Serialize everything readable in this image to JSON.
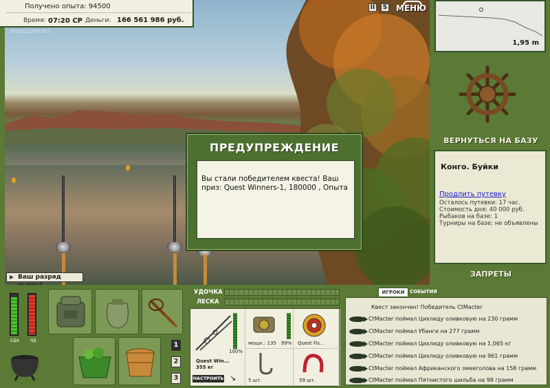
{
  "header": {
    "xp_text": "Получено опыта: 94500",
    "time_label": "Время:",
    "time_value": "07:20 СР",
    "money_label": "Деньги:",
    "money_value": "166 561 986 руб.",
    "watermark": "INSTALLSOFT.RU"
  },
  "controls": {
    "pause": "II",
    "sound": "S",
    "menu": "МЕНЮ"
  },
  "depth": {
    "value": "1,95 m"
  },
  "sidebar": {
    "return_base": "ВЕРНУТЬСЯ НА БАЗУ",
    "location_title": "Конго. Буйки",
    "extend_link": "Продлить путевку",
    "lines": [
      "Осталось путевки: 17 час.",
      "Стоимость дня: 40 000 руб.",
      "Рыбаков на базе: 1",
      "Турниры на базе: не объявлены"
    ],
    "bans": "ЗАПРЕТЫ"
  },
  "toast": {
    "text": "Ваш разряд вырос!"
  },
  "modal": {
    "title": "ПРЕДУПРЕЖДЕНИЕ",
    "body": "Вы стали победителем квеста! Ваш приз: Quest Winners-1, 180000 , Опыта"
  },
  "hud": {
    "food_label": "ЕДА",
    "poison_label": "ЯД",
    "food_level": 0.9,
    "poison_level": 0.95,
    "rod_label": "УДОЧКА",
    "line_label": "ЛЕСКА",
    "pages": [
      "1",
      "2",
      "3"
    ],
    "active_page": "1"
  },
  "tackle": {
    "rod_name": "Quest Win...",
    "rod_weight": "355 кг",
    "rod_condition": "100%",
    "reel_power": "мощн.: 135",
    "reel_condition": "99%",
    "line_name": "Quest Fis...",
    "hooks_count": "5 шт.",
    "bait_count": "59 шт.",
    "setup_button": "НАСТРОИТЬ"
  },
  "events": {
    "tab_players": "ИГРОКИ",
    "tab_events": "СОБЫТИЯ",
    "headline": "Квест закончен! Победитель CtMacter",
    "items": [
      "CtMacter поймал Цихлиду оливковую на 230 грамм",
      "CtMacter поймал Убанги на 277 грамм",
      "CtMacter поймал Цихлиду оливковую на 1,065 кг",
      "CtMacter поймал Цихлиду оливковую на 961 грамм",
      "CtMacter поймал Африканского змееголова на 158 грамм",
      "CtMacter поймал Пятнистого шильба на 98 грамм"
    ]
  },
  "colors": {
    "panel_green": "#5a7a35",
    "cream": "#ebe9d3",
    "link_blue": "#1a1ad0"
  }
}
